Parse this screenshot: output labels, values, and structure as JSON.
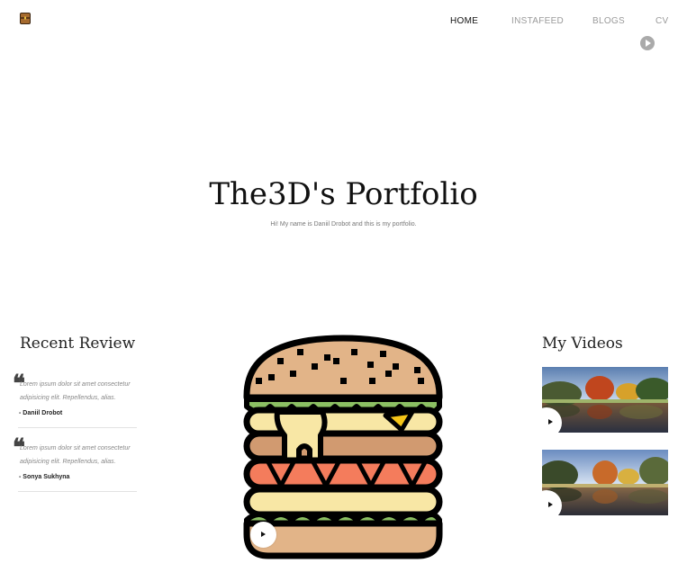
{
  "nav": {
    "items": [
      {
        "label": "HOME",
        "active": true
      },
      {
        "label": "INSTAFEED",
        "active": false
      },
      {
        "label": "BLOGS",
        "active": false
      },
      {
        "label": "CV",
        "active": false
      }
    ]
  },
  "hero": {
    "title": "The3D's Portfolio",
    "subtitle": "Hi! My name is Daniil Drobot and this is my portfolio."
  },
  "reviews": {
    "title": "Recent Review",
    "items": [
      {
        "text": "Lorem ipsum dolor sit amet consectetur adipisicing elit. Repellendus, alias.",
        "author": "- Daniil Drobot"
      },
      {
        "text": "Lorem ipsum dolor sit amet consectetur adipisicing elit. Repellendus, alias.",
        "author": "- Sonya Sukhyna"
      }
    ]
  },
  "videos": {
    "title": "My Videos"
  },
  "icons": {
    "logo": "treasure-chest-icon",
    "nav_play": "play-icon",
    "feature": "burger-illustration",
    "quote": "quote-icon"
  },
  "colors": {
    "accent": "#111111",
    "nav_inactive": "#9a9a9a",
    "bun": "#e2b488",
    "lettuce": "#8cc063",
    "cheese": "#f8e7a5",
    "tomato": "#f47c5c"
  }
}
